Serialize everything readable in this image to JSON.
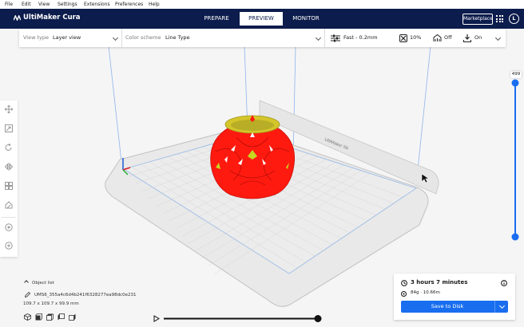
{
  "menu": [
    "File",
    "Edit",
    "View",
    "Settings",
    "Extensions",
    "Preferences",
    "Help"
  ],
  "app": {
    "title": "UltiMaker Cura"
  },
  "stages": [
    {
      "label": "PREPARE",
      "active": false
    },
    {
      "label": "PREVIEW",
      "active": true
    },
    {
      "label": "MONITOR",
      "active": false
    }
  ],
  "header": {
    "marketplace": "Marketplace",
    "avatar": "L"
  },
  "toolbar": {
    "view_type_label": "View type",
    "view_type_value": "Layer view",
    "color_scheme_label": "Color scheme",
    "color_scheme_value": "Line Type",
    "profile": "Fast - 0.2mm",
    "infill": "10%",
    "support": "Off",
    "adhesion": "On"
  },
  "left_tools": [
    "move-icon",
    "scale-icon",
    "rotate-icon",
    "mirror-icon",
    "per-model-settings-icon",
    "support-blocker-icon",
    "marketplace-plugin-icon",
    "digital-library-icon"
  ],
  "scene": {
    "printer_label": "UltiMaker S6"
  },
  "layer_slider": {
    "layer": "499",
    "level": 1.0
  },
  "layer_playback": {
    "progress": 1.0
  },
  "object_list": {
    "title": "Object list",
    "name": "UMS6_355a4c6d4b241f6328277ea98dc0e231",
    "dimensions": "109.7 x 109.7 x 99.9 mm"
  },
  "print_info": {
    "time": "3 hours 7 minutes",
    "material": "84g · 10.66m",
    "save_label": "Save to Disk"
  },
  "colors": {
    "brand": "#0c1c4c",
    "accent": "#196ef0",
    "model": "#ff1a10",
    "infill": "#d4c62a"
  }
}
